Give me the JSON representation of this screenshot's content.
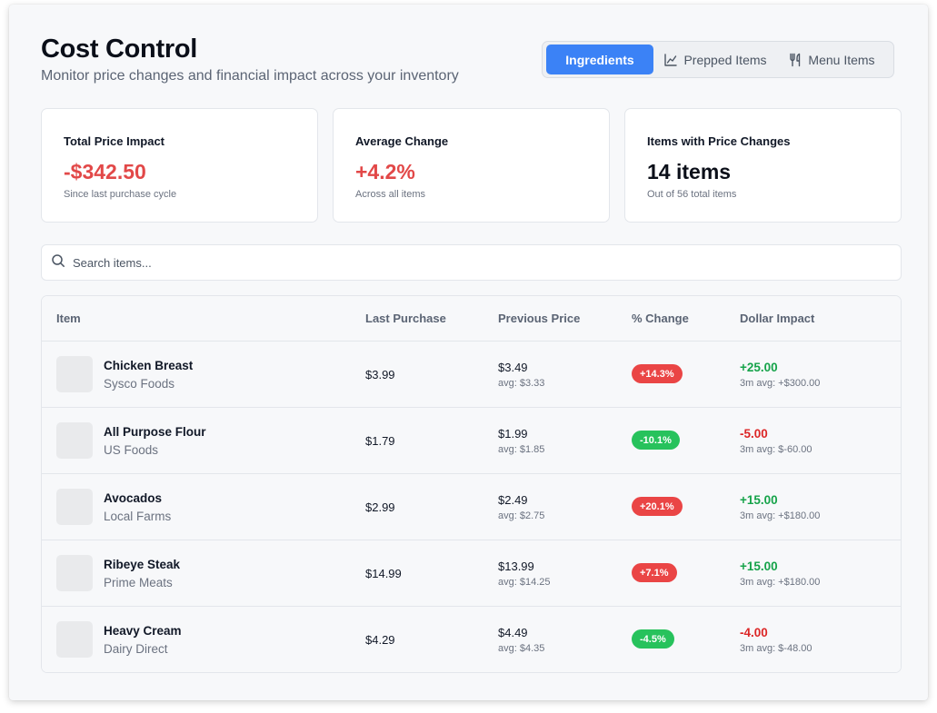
{
  "header": {
    "title": "Cost Control",
    "subtitle": "Monitor price changes and financial impact across your inventory"
  },
  "tabs": [
    {
      "label": "Ingredients",
      "icon": "none",
      "active": true
    },
    {
      "label": "Prepped Items",
      "icon": "chart-line-icon",
      "active": false
    },
    {
      "label": "Menu Items",
      "icon": "utensils-icon",
      "active": false
    }
  ],
  "stats": [
    {
      "label": "Total Price Impact",
      "value": "-$342.50",
      "note": "Since last purchase cycle",
      "color": "#e24848"
    },
    {
      "label": "Average Change",
      "value": "+4.2%",
      "note": "Across all items",
      "color": "#e24848"
    },
    {
      "label": "Items with Price Changes",
      "value": "14 items",
      "note": "Out of 56 total items",
      "color": "#0b0f19"
    }
  ],
  "search": {
    "placeholder": "Search items...",
    "value": ""
  },
  "table": {
    "headers": [
      "Item",
      "Last Purchase",
      "Previous Price",
      "% Change",
      "Dollar Impact"
    ],
    "rows": [
      {
        "name": "Chicken Breast",
        "supplier": "Sysco Foods",
        "last": "$3.99",
        "prev": "$3.49",
        "prev_avg": "avg: $3.33",
        "change": "+14.3%",
        "direction": "up",
        "impact": "+25.00",
        "impact_avg": "3m avg: +$300.00"
      },
      {
        "name": "All Purpose Flour",
        "supplier": "US Foods",
        "last": "$1.79",
        "prev": "$1.99",
        "prev_avg": "avg: $1.85",
        "change": "-10.1%",
        "direction": "down",
        "impact": "-5.00",
        "impact_avg": "3m avg: $-60.00"
      },
      {
        "name": "Avocados",
        "supplier": "Local Farms",
        "last": "$2.99",
        "prev": "$2.49",
        "prev_avg": "avg: $2.75",
        "change": "+20.1%",
        "direction": "up",
        "impact": "+15.00",
        "impact_avg": "3m avg: +$180.00"
      },
      {
        "name": "Ribeye Steak",
        "supplier": "Prime Meats",
        "last": "$14.99",
        "prev": "$13.99",
        "prev_avg": "avg: $14.25",
        "change": "+7.1%",
        "direction": "up",
        "impact": "+15.00",
        "impact_avg": "3m avg: +$180.00"
      },
      {
        "name": "Heavy Cream",
        "supplier": "Dairy Direct",
        "last": "$4.29",
        "prev": "$4.49",
        "prev_avg": "avg: $4.35",
        "change": "-4.5%",
        "direction": "down",
        "impact": "-4.00",
        "impact_avg": "3m avg: $-48.00"
      }
    ]
  },
  "colors": {
    "accent": "#3b82f6",
    "negative_value": "#e24848",
    "badge_up": "#ea4545",
    "badge_down": "#27c25c",
    "impact_pos": "#16a34a",
    "impact_neg": "#dc2626"
  }
}
